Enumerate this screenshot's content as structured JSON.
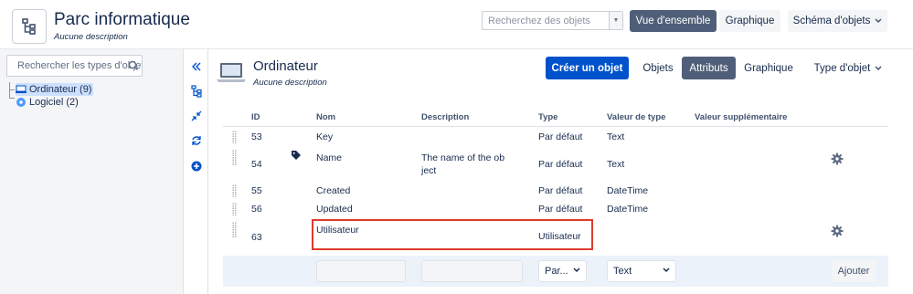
{
  "header": {
    "title": "Parc informatique",
    "description": "Aucune description",
    "search_placeholder": "Recherchez des objets",
    "buttons": [
      "Vue d'ensemble",
      "Graphique",
      "Schéma d'objets"
    ]
  },
  "sidebar": {
    "search_placeholder": "Rechercher les types d'objet",
    "tree": [
      {
        "label": "Ordinateur (9)",
        "selected": true
      },
      {
        "label": "Logiciel (2)",
        "selected": false
      }
    ]
  },
  "object_type": {
    "title": "Ordinateur",
    "description": "Aucune description",
    "create_button": "Créer un objet",
    "tabs": [
      "Objets",
      "Attributs",
      "Graphique"
    ],
    "active_tab": "Attributs",
    "type_menu": "Type d'objet"
  },
  "table": {
    "columns": [
      "ID",
      "Nom",
      "Description",
      "Type",
      "Valeur de type",
      "Valeur supplémentaire"
    ],
    "rows": [
      {
        "id": "53",
        "name": "Key",
        "description": "",
        "type": "Par défaut",
        "type_value": "Text"
      },
      {
        "id": "54",
        "name": "Name",
        "description_1": "The name of the ob",
        "description_2": "ject",
        "type": "Par défaut",
        "type_value": "Text"
      },
      {
        "id": "55",
        "name": "Created",
        "description": "",
        "type": "Par défaut",
        "type_value": "DateTime"
      },
      {
        "id": "56",
        "name": "Updated",
        "description": "",
        "type": "Par défaut",
        "type_value": "DateTime"
      },
      {
        "id": "63",
        "name": "Utilisateur",
        "description": "",
        "type": "Utilisateur",
        "type_value": ""
      }
    ]
  },
  "add_row": {
    "type_select": "Par...",
    "type_value_select": "Text",
    "add_button": "Ajouter"
  },
  "colors": {
    "primary": "#0052cc",
    "active": "#505f79",
    "highlight": "#e03b2b",
    "selected_tree": "#cce0ff"
  }
}
